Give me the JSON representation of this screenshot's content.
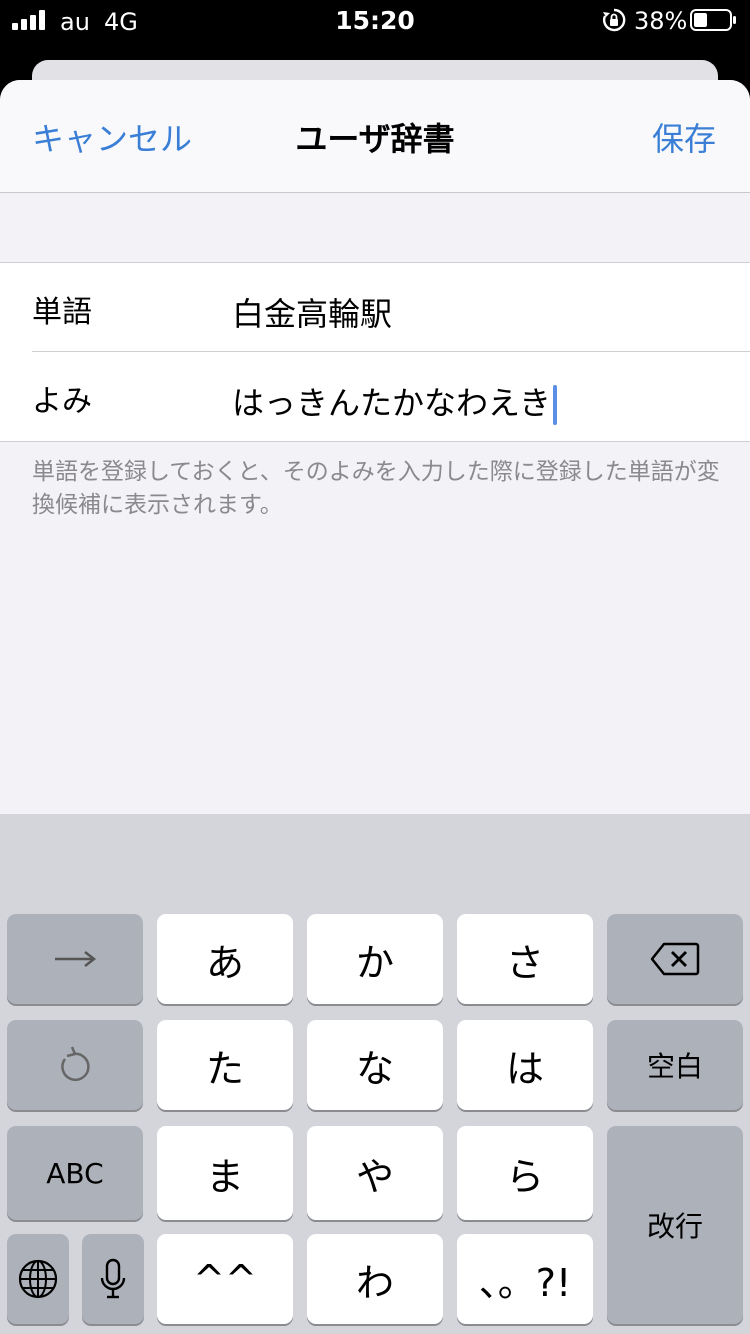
{
  "status_bar": {
    "carrier": "au",
    "network": "4G",
    "time": "15:20",
    "battery_percent": "38%"
  },
  "nav": {
    "cancel_label": "キャンセル",
    "title": "ユーザ辞書",
    "save_label": "保存"
  },
  "form": {
    "word_label": "単語",
    "word_value": "白金高輪駅",
    "reading_label": "よみ",
    "reading_value": "はっきんたかなわえき"
  },
  "footnote": "単語を登録しておくと、そのよみを入力した際に登録した単語が変換候補に表示されます。",
  "keyboard": {
    "row1": [
      "あ",
      "か",
      "さ"
    ],
    "row2": [
      "た",
      "な",
      "は"
    ],
    "row3": [
      "ま",
      "や",
      "ら"
    ],
    "row4": [
      "^^",
      "わ",
      "、。?!"
    ],
    "abc_label": "ABC",
    "space_label": "空白",
    "return_label": "改行"
  },
  "colors": {
    "accent": "#3a7fd5",
    "sheet_bg": "#f2f2f7",
    "keyboard_bg": "#d3d5db"
  },
  "icons": {
    "next": "arrow-right-icon",
    "undo": "undo-icon",
    "delete": "delete-backspace-icon",
    "globe": "globe-icon",
    "mic": "microphone-icon"
  }
}
